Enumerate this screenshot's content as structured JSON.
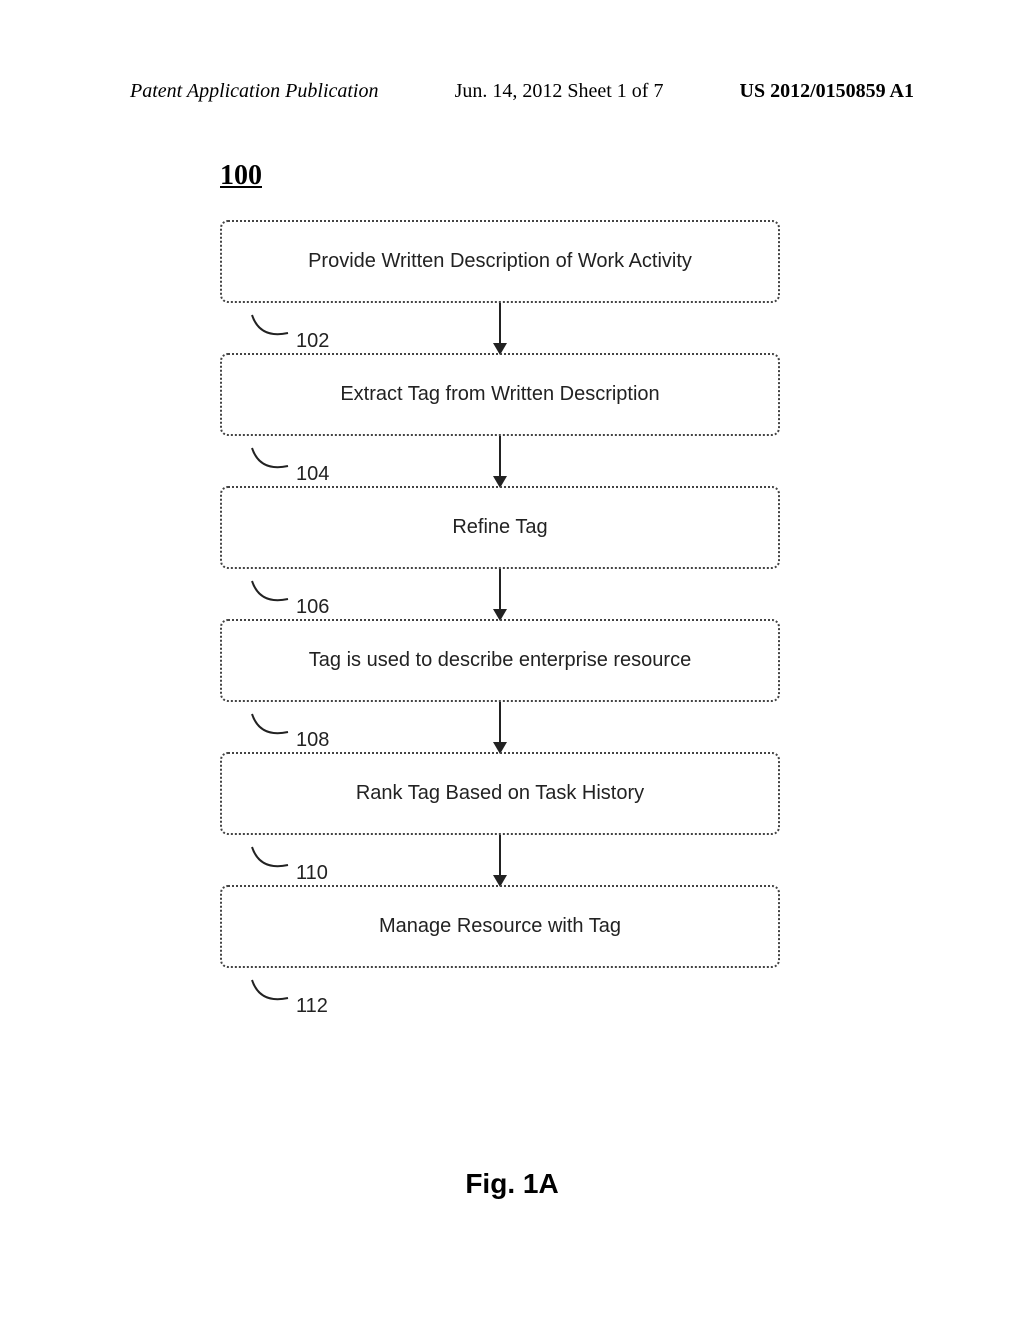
{
  "header": {
    "left": "Patent Application Publication",
    "center": "Jun. 14, 2012  Sheet 1 of 7",
    "right": "US 2012/0150859 A1"
  },
  "figure_ref": "100",
  "steps": [
    {
      "num": "102",
      "text": "Provide Written Description of Work Activity"
    },
    {
      "num": "104",
      "text": "Extract Tag from Written Description"
    },
    {
      "num": "106",
      "text": "Refine Tag"
    },
    {
      "num": "108",
      "text": "Tag is used to describe enterprise resource"
    },
    {
      "num": "110",
      "text": "Rank Tag Based on Task History"
    },
    {
      "num": "112",
      "text": "Manage Resource with Tag"
    }
  ],
  "figure_caption": "Fig. 1A",
  "chart_data": {
    "type": "flowchart",
    "title": "100",
    "nodes": [
      {
        "id": "102",
        "label": "Provide Written Description of Work Activity"
      },
      {
        "id": "104",
        "label": "Extract Tag from Written Description"
      },
      {
        "id": "106",
        "label": "Refine Tag"
      },
      {
        "id": "108",
        "label": "Tag is used to describe enterprise resource"
      },
      {
        "id": "110",
        "label": "Rank Tag Based on Task History"
      },
      {
        "id": "112",
        "label": "Manage Resource with Tag"
      }
    ],
    "edges": [
      {
        "from": "102",
        "to": "104"
      },
      {
        "from": "104",
        "to": "106"
      },
      {
        "from": "106",
        "to": "108"
      },
      {
        "from": "108",
        "to": "110"
      },
      {
        "from": "110",
        "to": "112"
      }
    ],
    "caption": "Fig. 1A"
  }
}
